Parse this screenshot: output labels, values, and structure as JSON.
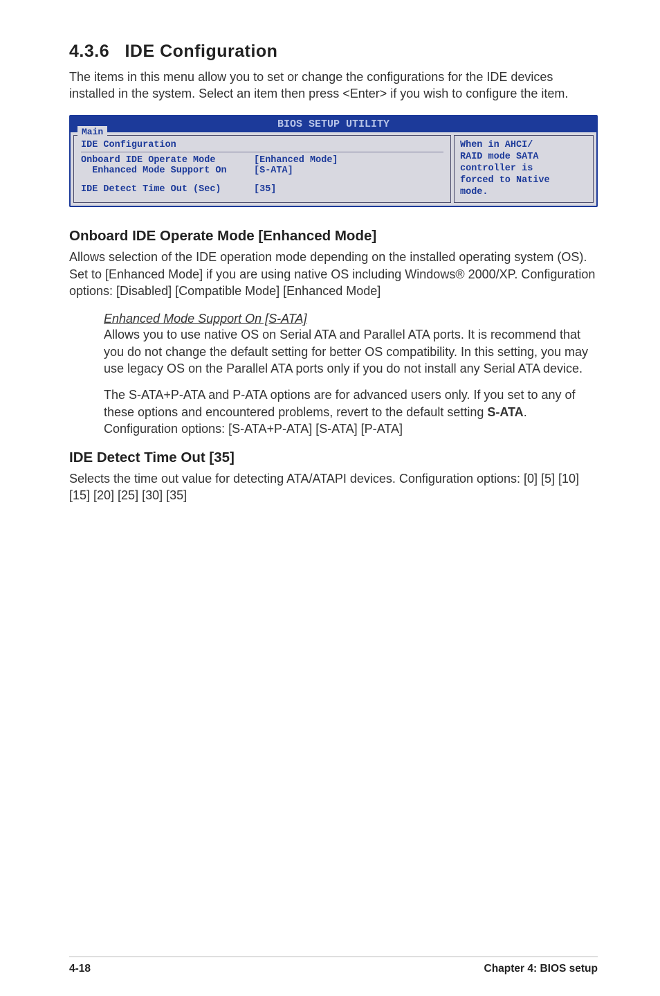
{
  "section": {
    "number": "4.3.6",
    "title": "IDE Configuration",
    "intro": "The items in this menu allow you to set or change the configurations for the IDE devices installed in the system. Select an item then press <Enter> if you wish to configure the item."
  },
  "bios": {
    "header": "BIOS SETUP UTILITY",
    "tab": "Main",
    "leftTitle": "IDE Configuration",
    "rows": [
      {
        "label": "Onboard IDE Operate Mode",
        "value": "[Enhanced Mode]"
      },
      {
        "label": "  Enhanced Mode Support On",
        "value": "[S-ATA]"
      }
    ],
    "row3": {
      "label": "IDE Detect Time Out (Sec)",
      "value": "[35]"
    },
    "help": "When in AHCI/\nRAID mode SATA\ncontroller is\nforced to Native\nmode."
  },
  "sub1": {
    "title": "Onboard IDE Operate Mode [Enhanced Mode]",
    "body": "Allows selection of the IDE operation mode depending on the installed operating system (OS). Set to [Enhanced Mode] if you are using native OS including Windows® 2000/XP. Configuration options: [Disabled] [Compatible Mode] [Enhanced Mode]"
  },
  "enhanced": {
    "title": "Enhanced Mode Support On [S-ATA]",
    "p1": "Allows you to use native OS on Serial ATA and Parallel ATA ports. It is recommend that you do not change the default setting for better OS compatibility. In this setting, you may use legacy OS on the Parallel ATA ports only if you do not install any Serial ATA device.",
    "p2a": "The S-ATA+P-ATA and P-ATA options are for advanced users only. If you set to any of these options and encountered problems, revert to the default setting ",
    "p2strong": "S-ATA",
    "p2b": ". Configuration options: [S-ATA+P-ATA] [S-ATA] [P-ATA]"
  },
  "sub2": {
    "title": "IDE Detect Time Out [35]",
    "body": "Selects the time out value for detecting ATA/ATAPI devices. Configuration options: [0] [5] [10] [15] [20] [25] [30] [35]"
  },
  "footer": {
    "left": "4-18",
    "right": "Chapter 4: BIOS setup"
  }
}
